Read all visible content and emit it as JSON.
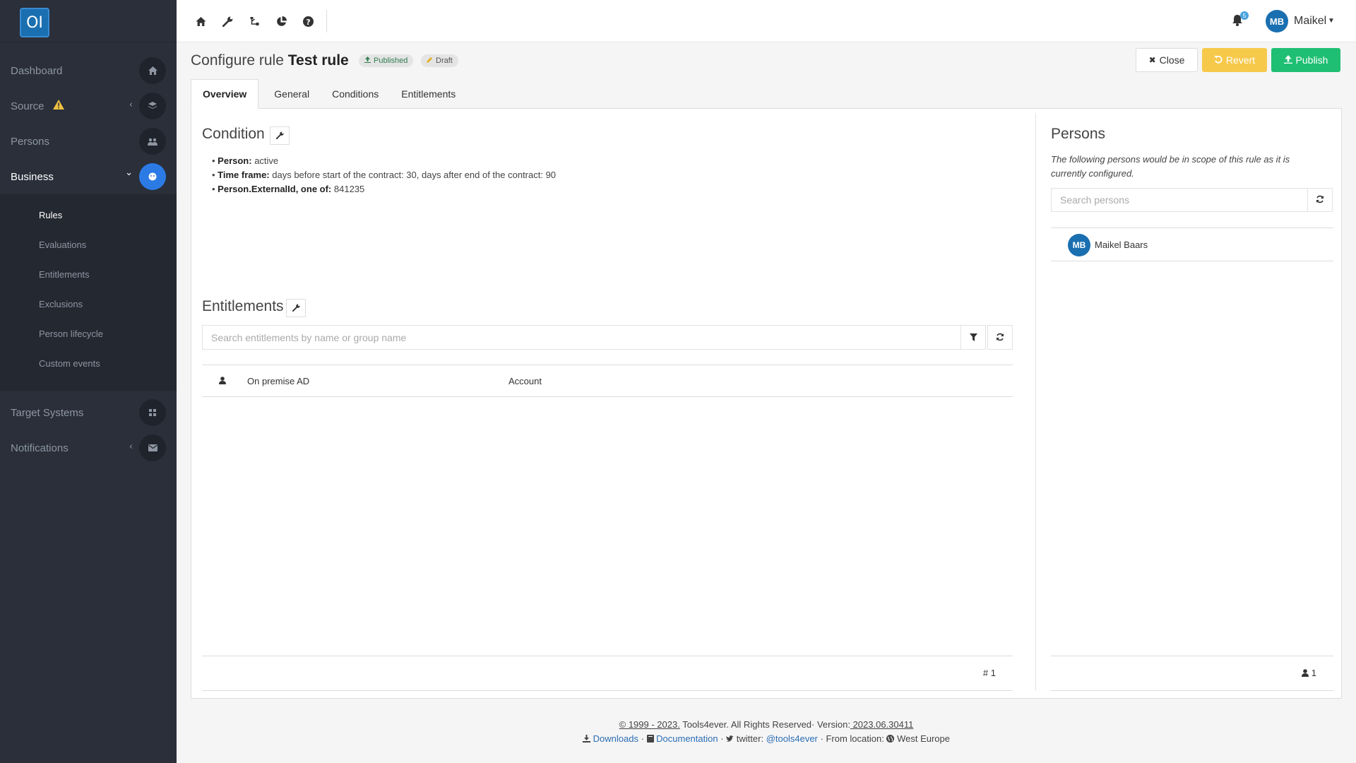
{
  "app": {
    "logo_text": "OI"
  },
  "sidebar": {
    "items": [
      {
        "label": "Dashboard",
        "icon": "home-icon"
      },
      {
        "label": "Source",
        "icon": "layers-icon",
        "warning": true,
        "chevron": "‹"
      },
      {
        "label": "Persons",
        "icon": "users-icon"
      },
      {
        "label": "Business",
        "icon": "business-icon",
        "chevron": "⌄",
        "active": true
      },
      {
        "label": "Target Systems",
        "icon": "grid-icon"
      },
      {
        "label": "Notifications",
        "icon": "envelope-icon",
        "chevron": "‹"
      }
    ],
    "business_sub": [
      "Rules",
      "Evaluations",
      "Entitlements",
      "Exclusions",
      "Person lifecycle",
      "Custom events"
    ]
  },
  "topbar": {
    "icons": [
      "home-icon",
      "wrench-icon",
      "sitemap-icon",
      "pie-chart-icon",
      "question-circle-icon"
    ],
    "notification_count": "5",
    "user_initials": "MB",
    "user_name": "Maikel"
  },
  "header": {
    "title_prefix": "Configure rule",
    "title_name": "Test rule",
    "badge_published": "Published",
    "badge_draft": "Draft",
    "close_label": "Close",
    "revert_label": "Revert",
    "publish_label": "Publish"
  },
  "tabs": [
    "Overview",
    "General",
    "Conditions",
    "Entitlements"
  ],
  "condition": {
    "title": "Condition",
    "items": [
      {
        "key": "Person:",
        "value": " active"
      },
      {
        "key": "Time frame:",
        "value": " days before start of the contract: 30, days after end of the contract: 90"
      },
      {
        "key": "Person.ExternalId, one of:",
        "value": " 841235"
      }
    ]
  },
  "entitlements": {
    "title": "Entitlements",
    "search_placeholder": "Search entitlements by name or group name",
    "rows": [
      {
        "system": "On premise AD",
        "type": "Account"
      }
    ],
    "count_label": "# 1"
  },
  "persons": {
    "title": "Persons",
    "description": "The following persons would be in scope of this rule as it is currently configured.",
    "search_placeholder": "Search persons",
    "list": [
      {
        "initials": "MB",
        "name": "Maikel Baars"
      }
    ],
    "count": "1"
  },
  "footer": {
    "copyright": "© 1999 - 2023.",
    "company": " Tools4ever. All Rights Reserved· Version:",
    "version": " 2023.06.30411",
    "downloads": "Downloads",
    "documentation": "Documentation",
    "twitter_label": "twitter:",
    "twitter_handle": "@tools4ever",
    "location_label": "From location:",
    "location": "West Europe"
  },
  "colors": {
    "sidebar_bg": "#2a2f3a",
    "accent_blue": "#2c7be5",
    "revert_yellow": "#f7c94b",
    "publish_green": "#1fbf73",
    "avatar_blue": "#1a6fb0"
  }
}
